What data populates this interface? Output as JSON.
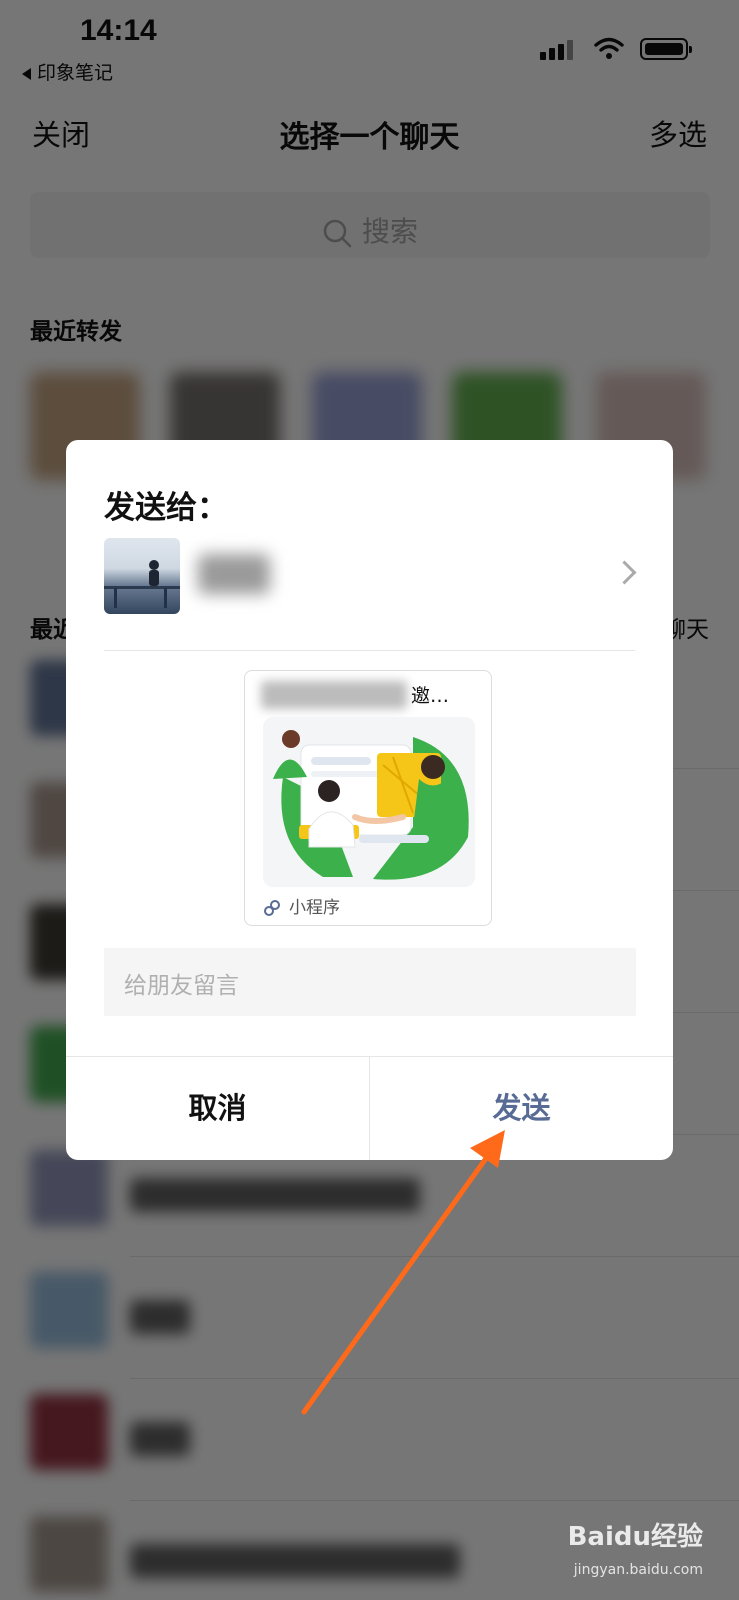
{
  "status_bar": {
    "time": "14:14",
    "back_app": "印象笔记"
  },
  "nav": {
    "close_label": "关闭",
    "title": "选择一个聊天",
    "multi_select_label": "多选"
  },
  "search": {
    "placeholder": "搜索"
  },
  "recent_forward": {
    "title": "最近转发"
  },
  "recent_chats": {
    "title_partial": "最近",
    "right_partial": "聊天"
  },
  "dialog": {
    "title": "发送给：",
    "card": {
      "title_suffix": "邀…",
      "mini_program_label": "小程序"
    },
    "message_placeholder": "给朋友留言",
    "cancel_label": "取消",
    "send_label": "发送"
  },
  "colors": {
    "send_accent": "#576b95",
    "arrow": "#ff6a1a",
    "card_green": "#3cb04a",
    "card_yellow": "#f5c518"
  },
  "watermark": {
    "brand": "Baidu经验",
    "url": "jingyan.baidu.com"
  }
}
